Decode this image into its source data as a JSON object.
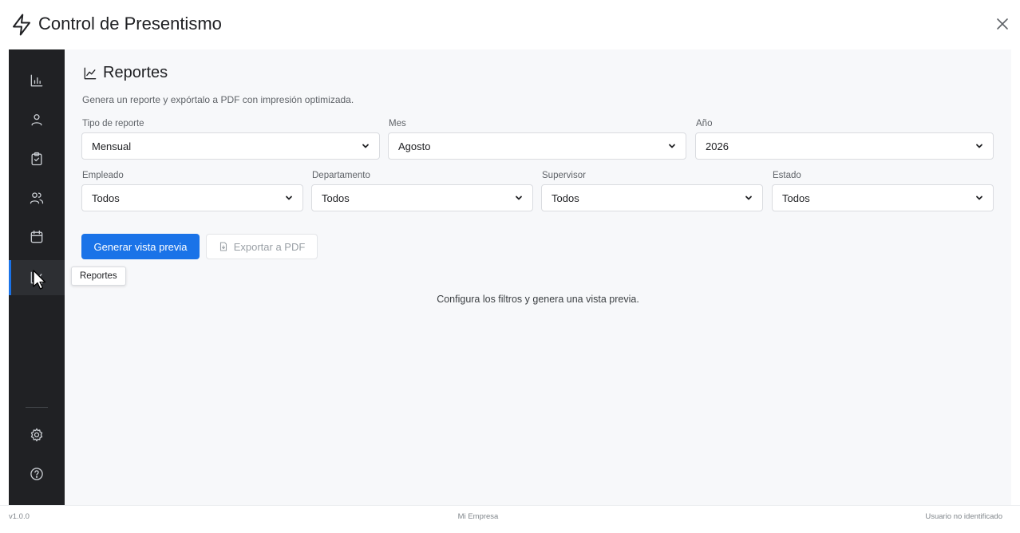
{
  "app": {
    "title": "Control de Presentismo",
    "accent_color": "#1a73e8",
    "sidebar_color": "#202124",
    "logo_icon": "lightning-bolt-icon"
  },
  "sidebar": {
    "items": [
      {
        "id": "dashboard",
        "icon": "bar-chart-icon",
        "active": false
      },
      {
        "id": "profile",
        "icon": "user-icon",
        "active": false
      },
      {
        "id": "attendance",
        "icon": "clipboard-check-icon",
        "active": false
      },
      {
        "id": "employees",
        "icon": "users-icon",
        "active": false
      },
      {
        "id": "calendar",
        "icon": "calendar-icon",
        "active": false
      },
      {
        "id": "reports",
        "icon": "line-chart-icon",
        "active": true
      }
    ],
    "bottom_items": [
      {
        "id": "settings",
        "icon": "gear-icon"
      },
      {
        "id": "help",
        "icon": "help-circle-icon"
      }
    ],
    "tooltip": "Reportes"
  },
  "main": {
    "title": "Reportes",
    "subtitle": "Genera un reporte y expórtalo a PDF con impresión optimizada.",
    "filters_row1": [
      {
        "label": "Tipo de reporte",
        "value": "Mensual"
      },
      {
        "label": "Mes",
        "value": "Agosto"
      },
      {
        "label": "Año",
        "value": "2026"
      }
    ],
    "filters_row2": [
      {
        "label": "Empleado",
        "value": "Todos"
      },
      {
        "label": "Departamento",
        "value": "Todos"
      },
      {
        "label": "Supervisor",
        "value": "Todos"
      },
      {
        "label": "Estado",
        "value": "Todos"
      }
    ],
    "generate_button": "Generar vista previa",
    "export_button": "Exportar a PDF",
    "empty_message": "Configura los filtros y genera una vista previa."
  },
  "footer": {
    "version": "v1.0.0",
    "company": "Mi Empresa",
    "user": "Usuario no identificado"
  }
}
